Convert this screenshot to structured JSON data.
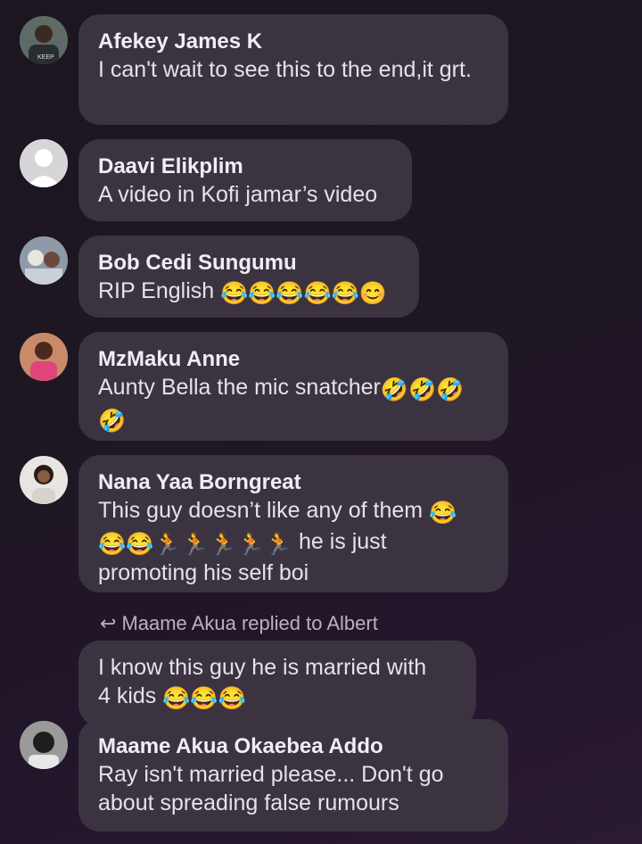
{
  "comments": [
    {
      "name": "Afekey James K",
      "text": "I can't wait to see this to the end,it grt.",
      "avatar": "photo"
    },
    {
      "name": "Daavi Elikplim",
      "text": "A video in Kofi jamar’s video",
      "avatar": "default"
    },
    {
      "name": "Bob Cedi Sungumu",
      "text": "RIP English",
      "avatar": "photo"
    },
    {
      "name": "MzMaku Anne",
      "text": "Aunty Bella the mic snatcher",
      "avatar": "photo"
    },
    {
      "name": "Nana Yaa Borngreat",
      "text_1": "This guy doesn’t like any of them",
      "text_2": "he is just",
      "text_3": "promoting his self boi",
      "avatar": "photo"
    }
  ],
  "reply_context": {
    "label": "Maame Akua replied to Albert"
  },
  "reply_comment": {
    "line1": "I  know this guy he is married with",
    "line2": "4 kids"
  },
  "last_comment": {
    "name": "Maame Akua Okaebea Addo",
    "text": "Ray isn't married please... Don't go about spreading false rumours",
    "avatar": "photo"
  },
  "colors": {
    "bubble": "#3b3440",
    "background": "#1e1722",
    "text": "#e6e1ea"
  },
  "icons": [
    "tears-of-joy-emoji",
    "smiling-emoji",
    "rolling-laughing-emoji",
    "person-running-emoji",
    "reply-arrow-icon",
    "default-avatar-icon"
  ]
}
